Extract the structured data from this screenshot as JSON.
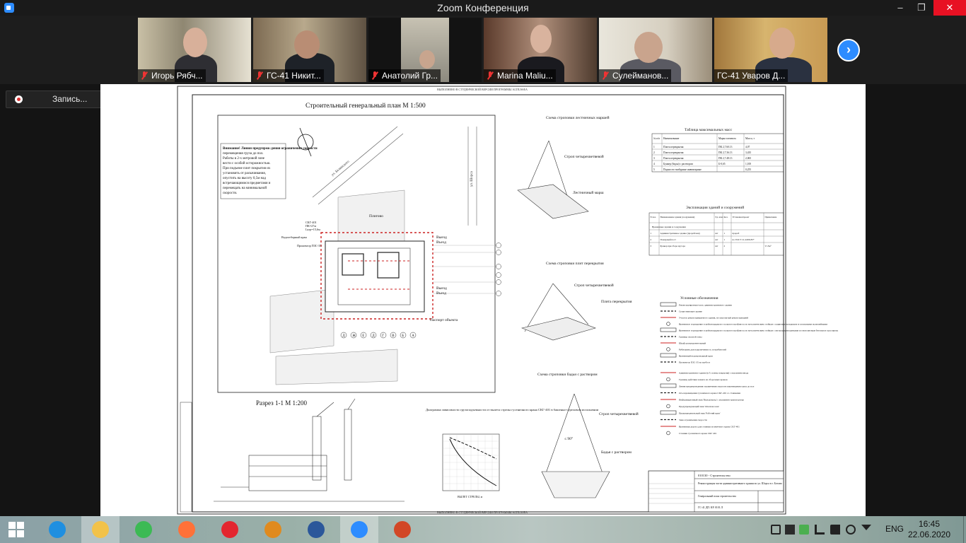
{
  "window": {
    "title": "Zoom Конференция",
    "controls": {
      "minimize": "–",
      "maximize": "❐",
      "close": "✕"
    }
  },
  "participants": [
    {
      "name": "Игорь Рябч...",
      "muted": true,
      "active": false
    },
    {
      "name": "ГС-41 Никит...",
      "muted": true,
      "active": false
    },
    {
      "name": "Анатолий Гр...",
      "muted": true,
      "active": false
    },
    {
      "name": "Marina Maliu...",
      "muted": true,
      "active": false
    },
    {
      "name": "Сулейманов...",
      "muted": true,
      "active": false
    },
    {
      "name": "ГС-41 Уваров Д...",
      "muted": false,
      "active": true
    }
  ],
  "strip_next_icon": "chevron-right-icon",
  "recording": {
    "label": "Запись..."
  },
  "drawing": {
    "title": "Строительный генеральный план   М 1:500",
    "section_title": "Разрез 1-1   М 1:200",
    "watermark": "ВЫПОЛНЕНО В СТУДЕНЧЕСКОЙ ВЕРСИИ ПРОГРАММЫ ALTIUSSEA",
    "warning_head": "Внимание! Линия предупреж-дения ограничения скорости",
    "warning_lines": [
      "перемещения груза до пол.",
      "Работы в 2-х метровой зоне",
      "вести с особой осторожностью.",
      "При подъеме плит покрытия их",
      "установить от раскачивания,",
      "опустить на высоту 0,5м над",
      "встречающимися предметами и",
      "перемещать на минимальной",
      "скорости."
    ],
    "street_1": "ул. Белинского",
    "street_2": "ул. Шорса",
    "labels": {
      "crane": "СКГ-401",
      "crane_sub": "ПК=27м",
      "crane_len": "Lкгр=15,6м",
      "water": "Водоотборный кран",
      "lighting": "Прожектор ПЗС-35",
      "sign": "Плигово",
      "exit1": "Выезд",
      "exit2": "Въезд",
      "passport": "Паспорт объекта"
    },
    "axes_letters": [
      "Д",
      "Ж",
      "Е",
      "Д",
      "Г",
      "В",
      "Б",
      "А"
    ],
    "scheme1_title": "Схема строповки лестничных маршей",
    "scheme1_a": "Строп четырехветвевой",
    "scheme1_b": "Лестничный марш",
    "scheme2_title": "Схема строповки плит перекрытия",
    "scheme2_a": "Строп четырехветвевой",
    "scheme2_b": "Плита перекрытия",
    "scheme3_title": "Схема строповки бадьи с раствором",
    "scheme3_a": "Строп четырехветвевой",
    "scheme3_b": "Бадья с раствором",
    "scheme3_angle": "≤ 90°",
    "mass_table": {
      "title": "Таблица максимальных масс",
      "headers": [
        "№ п/п",
        "Наименование",
        "Марка элемента",
        "Масса, т"
      ],
      "rows": [
        [
          "1",
          "Плита перекрытия",
          "ПК 2,7.60.13",
          "4,07"
        ],
        [
          "2",
          "Плита перекрытия",
          "ПК 2,7.36.13",
          "3,435"
        ],
        [
          "3",
          "Плита перекрытия",
          "ПК 2,7.48.13",
          "2,065"
        ],
        [
          "4",
          "Бункер (бадья) с раствором",
          "Б-0,65",
          "1,100"
        ],
        [
          "5",
          "Подмости тамбурные инвентарные",
          "",
          "0,255"
        ]
      ]
    },
    "buildings_table": {
      "title": "Экспликация зданий и сооружений",
      "headers": [
        "N поз.",
        "Наименование здания (сооружения)",
        "Ед. изм.",
        "Кол.",
        "Установка/проект",
        "Примечание"
      ],
      "group": "Временные здания и сооружения",
      "rows": [
        [
          "1",
          "Административное здание (прорабская)",
          "шт",
          "1",
          "прораб",
          ""
        ],
        [
          "2",
          "Пожарный пост",
          "шт",
          "1",
          "по ГОСТ 12.4.009-83*",
          ""
        ],
        [
          "3",
          "Бункер при сборе мусора",
          "шт",
          "2",
          "",
          "V=3м³"
        ]
      ]
    },
    "legend": {
      "title": "Условные обозначения",
      "items": [
        "Реконструируемая часть административного здания",
        "Существующее здание",
        "Участок реконструируемого здания, не затронутый реконструкцией",
        "Временное ограждение стройплощадки из стального профлиста по металлическим стойкам с защитным козырьком и сплошными жалюзийными",
        "Временное ограждение стройплощадки из стального профлиста по металлическим стойкам с сигнальными щитками по монолитным бетонам и трассирова",
        "Граница опасной зоны",
        "Шкаф распределительный",
        "Рубильник для подключения эл. потребителей",
        "Временный водопроводный кран",
        "Прожектор ПЗС-35 на трубосе",
        "Административное здание (в б. плиты покрытия) с указанием ввода",
        "Граница действия захвата из сборочных кранов",
        "Линия предупреждения ограничения скорости перемещения груза до пол",
        "Ось перемещения гусеничного крана СКГ-401 со стоянками",
        "Информационный знак 'Выезд/въезд' с указанием транспортера",
        "Предупреждающий знак 'Опасная зона'",
        "Предупредительный знак 'Рабочий кран'",
        "Знак ограничения скорости",
        "Временная дорога для стоянки гусеничного крана СКГ-401",
        "Стоянки гусеничного крана СКГ 401"
      ]
    },
    "graph_title": "Диаграмма зависимости грузоподъемности от вылета стрелы гусеничного крана СКГ-401 в башенно-стреловом исполнении",
    "graph_xlabel": "ВЫЛЕТ СТРЕЛЫ, м",
    "stamp": {
      "code": "010130 - Строительство",
      "project": "Реконструкция части административного здания по ул. Шорса в г. Белово",
      "sheet": "Генеральный план строительства",
      "row2": "ГС-41 ДП. КР. 0101.Л"
    }
  },
  "taskbar": {
    "apps": [
      {
        "name": "ie-icon",
        "color": "#1f8fe0",
        "active": false
      },
      {
        "name": "file-explorer-icon",
        "color": "#f2c24a",
        "active": true
      },
      {
        "name": "chrome-icon",
        "color": "#3cba54",
        "active": false
      },
      {
        "name": "firefox-icon",
        "color": "#ff7139",
        "active": false
      },
      {
        "name": "opera-icon",
        "color": "#e3262f",
        "active": false
      },
      {
        "name": "notes-app-icon",
        "color": "#e08a1e",
        "active": false
      },
      {
        "name": "word-icon",
        "color": "#2b579a",
        "active": false
      },
      {
        "name": "zoom-icon",
        "color": "#2d8cff",
        "active": true
      },
      {
        "name": "powerpoint-icon",
        "color": "#d24726",
        "active": false
      }
    ],
    "language": "ENG",
    "time": "16:45",
    "date": "22.06.2020"
  }
}
